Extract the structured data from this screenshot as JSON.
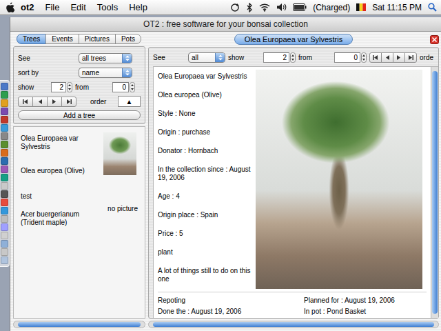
{
  "menubar": {
    "app": "ot2",
    "menus": [
      "File",
      "Edit",
      "Tools",
      "Help"
    ],
    "battery": "(Charged)",
    "clock": "Sat 11:15 PM"
  },
  "window": {
    "title": "OT2 : free software for your bonsai collection"
  },
  "left_panel": {
    "tabs": [
      {
        "label": "Trees",
        "selected": true
      },
      {
        "label": "Events",
        "selected": false
      },
      {
        "label": "Pictures",
        "selected": false
      },
      {
        "label": "Pots",
        "selected": false
      }
    ],
    "filters": {
      "see_label": "See",
      "see_value": "all trees",
      "sort_label": "sort by",
      "sort_value": "name",
      "show_label": "show",
      "show_value": "2",
      "from_label": "from",
      "from_value": "0",
      "order_label": "order",
      "order_value": "▲"
    },
    "add_button": "Add a tree",
    "trees": [
      {
        "name": "Olea Europaea var Sylvestris",
        "species": "Olea europea (Olive)",
        "has_picture": true
      },
      {
        "name": "test",
        "species": "Acer buergerianum (Trident maple)",
        "has_picture": false,
        "picture_label": "no picture"
      }
    ]
  },
  "detail": {
    "title": "Olea Europaea var Sylvestris",
    "filters": {
      "see_label": "See",
      "see_value": "all",
      "show_label": "show",
      "show_value": "2",
      "from_label": "from",
      "from_value": "0",
      "order_label": "orde"
    },
    "fields": [
      "Olea Europaea var Sylvestris",
      "Olea europea (Olive)",
      "Style : None",
      "Origin : purchase",
      "Donator : Hornbach",
      "In the collection since : August 19, 2006",
      "Age : 4",
      "Origin place : Spain",
      "Price : 5",
      "plant",
      "A lot of things still to do on this one"
    ],
    "event": {
      "name": "Repoting",
      "planned": "Planned for : August 19, 2006",
      "done": "Done the : August 19, 2006",
      "pot": "In pot : Pond Basket"
    }
  }
}
